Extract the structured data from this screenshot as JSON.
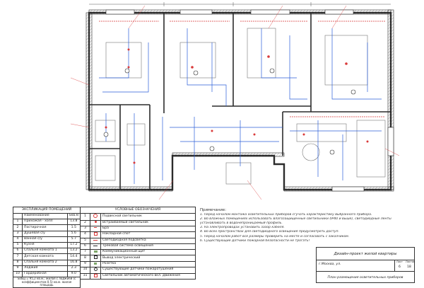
{
  "explication": {
    "title": "ЭКСПЛИКАЦИЯ ПОМЕЩЕНИЙ",
    "headers": [
      "",
      "Наименование",
      "Sкв.м"
    ],
    "rows": [
      [
        "1",
        "Прихожая - холл",
        "13.8"
      ],
      [
        "2",
        "Постирочная",
        "1.5"
      ],
      [
        "3",
        "Душевая с/у",
        "5.6"
      ],
      [
        "4",
        "Ванная с/у",
        "5.7"
      ],
      [
        "5",
        "Кухня",
        "17.2"
      ],
      [
        "6",
        "Спальня комната 1",
        "13.2"
      ],
      [
        "7",
        "Детская комната",
        "14.4"
      ],
      [
        "8",
        "Спальня комната 2",
        "16.8"
      ],
      [
        "9",
        "Лоджия",
        "2.3"
      ],
      [
        "10",
        "Гардеробная",
        "9.0"
      ]
    ],
    "footer": "Sобщ = 95,2 кв.м.; жилая с лоджией (с коэффициентом 0.5) кв.м. жилая площадь"
  },
  "legend": {
    "title": "УСЛОВНЫЕ ОБОЗНАЧЕНИЯ",
    "rows": [
      [
        "1",
        "Подвесной светильник"
      ],
      [
        "2",
        "Встраиваемый светильник"
      ],
      [
        "3",
        "Бра"
      ],
      [
        "4",
        "Накладной спот"
      ],
      [
        "5",
        "Светодиодная подсветка"
      ],
      [
        "6",
        "Трековая система освещения"
      ],
      [
        "7",
        "Коммуникационный щит"
      ],
      [
        "8",
        "Вывод электрический"
      ],
      [
        "9",
        "Розетка"
      ],
      [
        "10",
        "Существующие датчики пожаротушения"
      ],
      [
        "11",
        "Светильник автоматического вкл. Движения"
      ]
    ]
  },
  "notes": {
    "title": "Примечание:",
    "lines": [
      "1. Перед началом монтажа осветительных приборов сгучать характеристику выбранного прибора.",
      "2. Во влажных помещениях использовать влагозащищенные светильники (IP40 и выше), светодиодные ленты",
      "   устанавливать в водонепроницаемый профиль.",
      "3. На электропроводах установить зазор кабеля.",
      "4. Во всех пространствах для светодиодного освещения предусмотреть доступ.",
      "5. Перед началом работ все размеры проверить на месте и согласовать с заказчиком.",
      "6. Существующие датчики пожарной безопасности не трогать!"
    ]
  },
  "stamp": {
    "title": "Дизайн-проект жилой квартиры",
    "address": "г.Москва, ул.",
    "sheet_label": "Лист",
    "sheets_label": "Листов",
    "sheet": "6",
    "sheets": "18",
    "drawing": "План размещения осветительных приборов"
  },
  "colors": {
    "walls": "#2b2b2b",
    "wiring": "#2b5fd9",
    "fixtures": "#d93a3a",
    "leader": "#d93a3a",
    "cabinet": "#7fa86a"
  }
}
